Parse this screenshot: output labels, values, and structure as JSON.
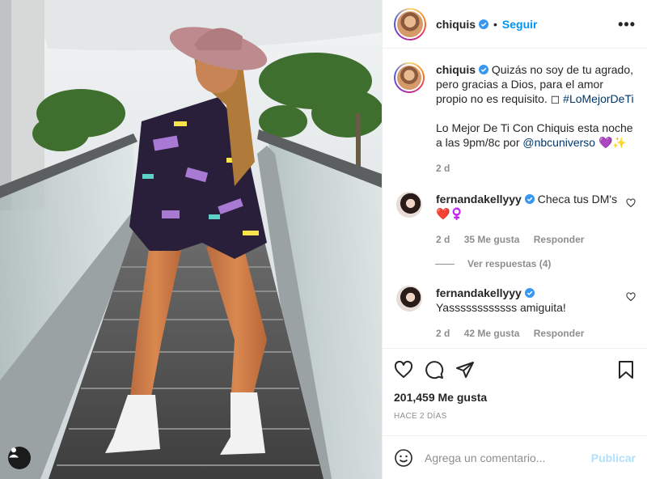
{
  "post": {
    "username": "chiquis",
    "follow_label": "Seguir",
    "separator": "•",
    "more_label": "•••"
  },
  "caption": {
    "username": "chiquis",
    "text": "Quizás no soy de tu agrado, pero gracias a Dios, para el amor propio no es requisito. ◻ ",
    "hashtag": "#LoMejorDeTi",
    "text2": "Lo Mejor De Ti Con Chiquis esta noche a las 9pm/8c por ",
    "mention": "@nbcuniverso",
    "emoji": " 💜✨",
    "time": "2 d"
  },
  "comments": [
    {
      "username": "fernandakellyyy",
      "text": "Checa tus DM's ❤️♀️",
      "time": "2 d",
      "likes": "35 Me gusta",
      "reply_label": "Responder",
      "view_replies": "Ver respuestas (4)"
    },
    {
      "username": "fernandakellyyy",
      "text": "Yassssssssssss amiguita!",
      "time": "2 d",
      "likes": "42 Me gusta",
      "reply_label": "Responder"
    }
  ],
  "stats": {
    "likes": "201,459 Me gusta",
    "posted": "HACE 2 DÍAS"
  },
  "add_comment": {
    "placeholder": "Agrega un comentario...",
    "publish_label": "Publicar"
  },
  "icons": {
    "like": "heart-icon",
    "comment": "comment-icon",
    "share": "paper-plane-icon",
    "save": "bookmark-icon",
    "emoji": "smiley-icon",
    "more": "ellipsis-icon",
    "verified": "verified-badge-icon",
    "tag": "user-tag-icon"
  },
  "colors": {
    "link": "#0095f6",
    "hashtag": "#00376b",
    "muted": "#8e8e8e",
    "publish_disabled": "#b2dffc",
    "heart": "#ed4956"
  }
}
